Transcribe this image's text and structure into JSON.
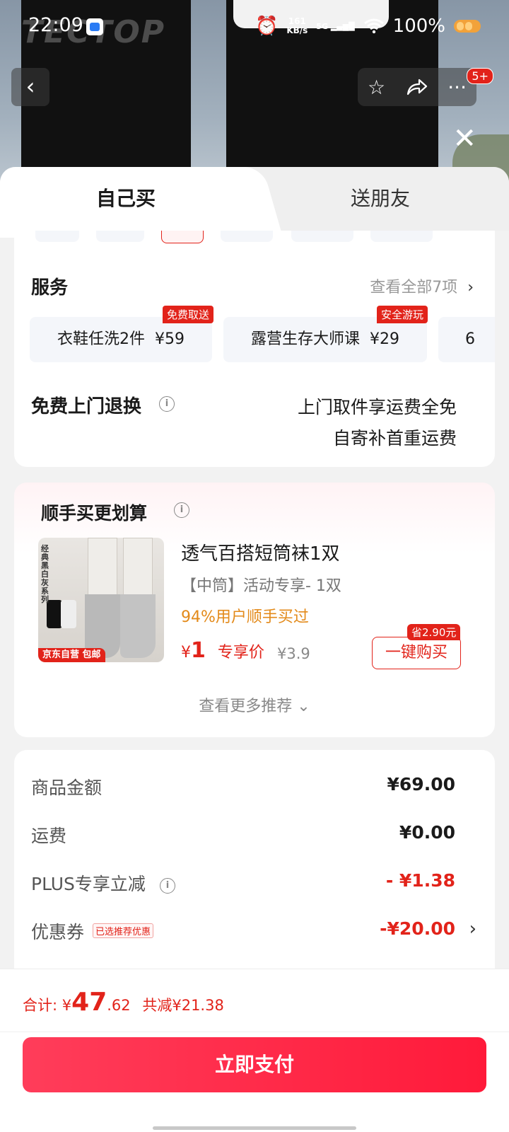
{
  "status_bar": {
    "time": "22:09",
    "net_speed": "161",
    "net_unit": "KB/s",
    "signal": "5G",
    "battery": "100%"
  },
  "nav": {
    "back_icon": "chevron-left-icon",
    "badge": "5+",
    "close_icon": "close-icon"
  },
  "tabs": [
    {
      "label": "自己买",
      "active": true
    },
    {
      "label": "送朋友",
      "active": false
    }
  ],
  "services": {
    "title": "服务",
    "more": "查看全部7项",
    "items": [
      {
        "tag": "免费取送",
        "label": "衣鞋任洗2件",
        "price": "¥59"
      },
      {
        "tag": "安全游玩",
        "label": "露营生存大师课",
        "price": "¥29"
      },
      {
        "tag": "",
        "label": "6",
        "price": ""
      }
    ]
  },
  "returns": {
    "title": "免费上门退换",
    "line1": "上门取件享运费全免",
    "line2": "自寄补首重运费"
  },
  "recommend": {
    "title": "顺手买更划算",
    "product_name": "透气百搭短筒袜1双",
    "spec": "【中筒】活动专享- 1双",
    "rate": "94%用户顺手买过",
    "currency": "¥",
    "price": "1",
    "price_label": "专享价",
    "original_price": "¥3.9",
    "buy_label": "一键购买",
    "save_tag": "省2.90元",
    "see_more": "查看更多推荐",
    "image_badge": "京东自营 包邮",
    "image_text": "经典黑白灰系列"
  },
  "summary": {
    "rows": [
      {
        "label": "商品金额",
        "value": "¥69.00"
      },
      {
        "label": "运费",
        "value": "¥0.00"
      },
      {
        "label": "PLUS专享立减",
        "value": "- ¥1.38"
      },
      {
        "label": "优惠券",
        "tag": "已选推荐优惠",
        "value": "-¥20.00"
      }
    ]
  },
  "bottom": {
    "total_label": "合计:",
    "currency": "¥",
    "total_int": "47",
    "total_dec": ".62",
    "discount": "共减¥21.38",
    "pay_label": "立即支付"
  },
  "colors": {
    "accent": "#e2231a",
    "pay_gradient_start": "#ff3d5a",
    "pay_gradient_end": "#ff1a3a",
    "rate_orange": "#e38a1a"
  }
}
